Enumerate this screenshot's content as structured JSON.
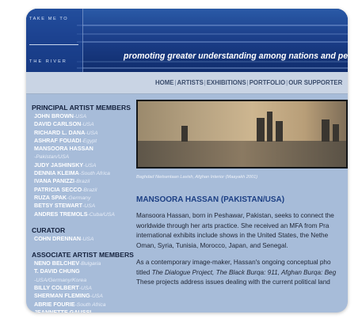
{
  "logo": {
    "top": "TAKE ME TO",
    "bottom": "THE RIVER"
  },
  "tagline": "promoting greater understanding among nations and peoples t",
  "nav": [
    "HOME",
    "ARTISTS",
    "EXHIBITIONS",
    "PORTFOLIO",
    "OUR SUPPORTER"
  ],
  "sidebar": {
    "principal_heading": "PRINCIPAL ARTIST MEMBERS",
    "principal": [
      {
        "name": "JOHN BROWN",
        "country": "-USA"
      },
      {
        "name": "DAVID CARLSON",
        "country": "-USA"
      },
      {
        "name": "RICHARD L. DANA",
        "country": "-USA"
      },
      {
        "name": "ASHRAF FOUADI",
        "country": "-Egypt"
      },
      {
        "name": "MANSOORA HASSAN",
        "country": ""
      },
      {
        "name": "",
        "country": "-Pakistan/USA"
      },
      {
        "name": "JUDY JASHINSKY",
        "country": "-USA"
      },
      {
        "name": "DENNIA KLEIMA",
        "country": "-South Africa"
      },
      {
        "name": "IVANA PANIZZI",
        "country": "-Brazil"
      },
      {
        "name": "PATRICIA SECCO",
        "country": "-Brazil"
      },
      {
        "name": "RUZA SPAK",
        "country": "-Germany"
      },
      {
        "name": "BETSY STEWART",
        "country": "-USA"
      },
      {
        "name": "ANDRES TREMOLS",
        "country": "-Cuba/USA"
      }
    ],
    "curator_heading": "CURATOR",
    "curator": [
      {
        "name": "COHN DRENNAN",
        "country": "-USA"
      }
    ],
    "associate_heading": "ASSOCIATE ARTIST MEMBERS",
    "associate": [
      {
        "name": "NENO BELCHEV",
        "country": "-Bulgaria"
      },
      {
        "name": "T. DAVID CHUNG",
        "country": ""
      },
      {
        "name": "",
        "country": "-USA/Germany/Korea"
      },
      {
        "name": "BILLY COLBERT",
        "country": "-USA"
      },
      {
        "name": "SHERMAN FLEMING",
        "country": "-USA"
      },
      {
        "name": "ABRIE FOURIE",
        "country": "-South Africa"
      },
      {
        "name": "JEANNETTE GAUSSI",
        "country": ""
      }
    ]
  },
  "content": {
    "caption": "Baghdad Nietsentaan Lavish, Afghan Interior (Maayakh 2001)",
    "title": "MANSOORA HASSAN (PAKISTAN/USA)",
    "para1": [
      "Mansoora Hassan, born in Peshawar, Pakistan, seeks to connect the",
      "worldwide through her arts practice. She received an MFA from Pra",
      "international exhibits include shows in the United States, the Nethe",
      "Oman, Syria, Tunisia, Morocco, Japan, and Senegal."
    ],
    "para2": [
      "As a contemporary image-maker, Hassan's ongoing conceptual pho",
      "These projects address issues dealing with the current political land"
    ],
    "para2_titled": {
      "prefix": "titled ",
      "work1": "The Dialogue Project, The Black Burqa: 911, Afghan Burqa: Beg"
    }
  },
  "colors": {
    "background": "#a7bcd9",
    "banner": "#1c3f8a",
    "title": "#1c3f84"
  }
}
